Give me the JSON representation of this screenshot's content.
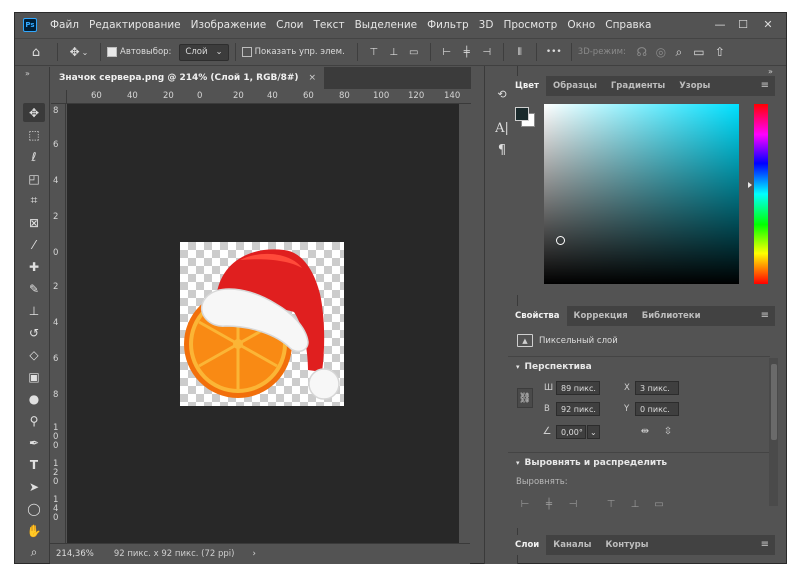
{
  "app": {
    "logo_text": "Ps",
    "menu": [
      "Файл",
      "Редактирование",
      "Изображение",
      "Слои",
      "Текст",
      "Выделение",
      "Фильтр",
      "3D",
      "Просмотр",
      "Окно",
      "Справка"
    ],
    "window_controls": {
      "minimize": "—",
      "maximize": "☐",
      "close": "✕"
    }
  },
  "options": {
    "autoselect_label": "Автовыбор:",
    "autoselect_checked": true,
    "autoselect_value": "Слой",
    "show_transform_label": "Показать упр. элем.",
    "show_transform_checked": false,
    "mode_3d_label": "3D-режим:",
    "more_label": "•••"
  },
  "document": {
    "tab_title": "Значок сервера.png @ 214% (Слой 1, RGB/8#)",
    "tab_close": "×",
    "ruler_top": [
      "60",
      "40",
      "20",
      "0",
      "20",
      "40",
      "60",
      "80",
      "100",
      "120",
      "140"
    ],
    "ruler_left": [
      "8",
      "6",
      "4",
      "2",
      "0",
      "2",
      "4",
      "6",
      "8",
      "1 0 0",
      "1 2 0",
      "1 4 0"
    ]
  },
  "status": {
    "zoom": "214,36%",
    "doc_info": "92 пикс. x 92 пикс. (72 ppi)",
    "arrow": "›"
  },
  "color_panel": {
    "tabs": [
      "Цвет",
      "Образцы",
      "Градиенты",
      "Узоры"
    ],
    "active_tab": 0,
    "hue_color": "#00e0ff",
    "foreground": "#1a2a2c",
    "background": "#ffffff"
  },
  "properties_panel": {
    "tabs": [
      "Свойства",
      "Коррекция",
      "Библиотеки"
    ],
    "active_tab": 0,
    "layer_type": "Пиксельный слой",
    "perspective_label": "Перспектива",
    "w_label": "Ш",
    "w_value": "89 пикс.",
    "h_label": "В",
    "h_value": "92 пикс.",
    "x_label": "X",
    "x_value": "3 пикс.",
    "y_label": "Y",
    "y_value": "0 пикс.",
    "angle_value": "0,00°",
    "align_section": "Выровнять и распределить",
    "align_label": "Выровнять:"
  },
  "layers_panel": {
    "tabs": [
      "Слои",
      "Каналы",
      "Контуры"
    ],
    "active_tab": 0
  },
  "collapse_arrows": "»"
}
